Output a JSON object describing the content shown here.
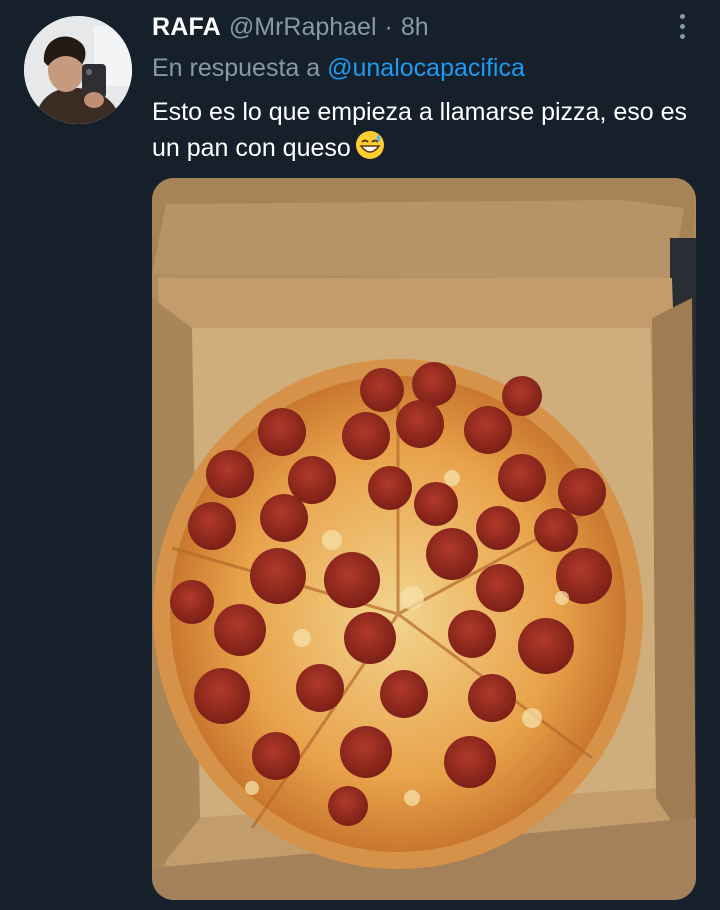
{
  "tweet": {
    "display_name": "RAFA",
    "handle": "@MrRaphael",
    "separator": "·",
    "timestamp": "8h",
    "reply_prefix": "En respuesta a",
    "reply_mention": "@unalocapacifica",
    "text": "Esto es lo que empieza a llamarse pizza, eso es un pan con queso",
    "emoji": "grinning-face-with-sweat"
  },
  "icons": {
    "more": "more-options-icon",
    "avatar": "profile-avatar",
    "media": "pizza-photo"
  },
  "colors": {
    "background": "#15202b",
    "primary_text": "#ffffff",
    "secondary_text": "#8899a6",
    "link": "#1d9bf0"
  }
}
